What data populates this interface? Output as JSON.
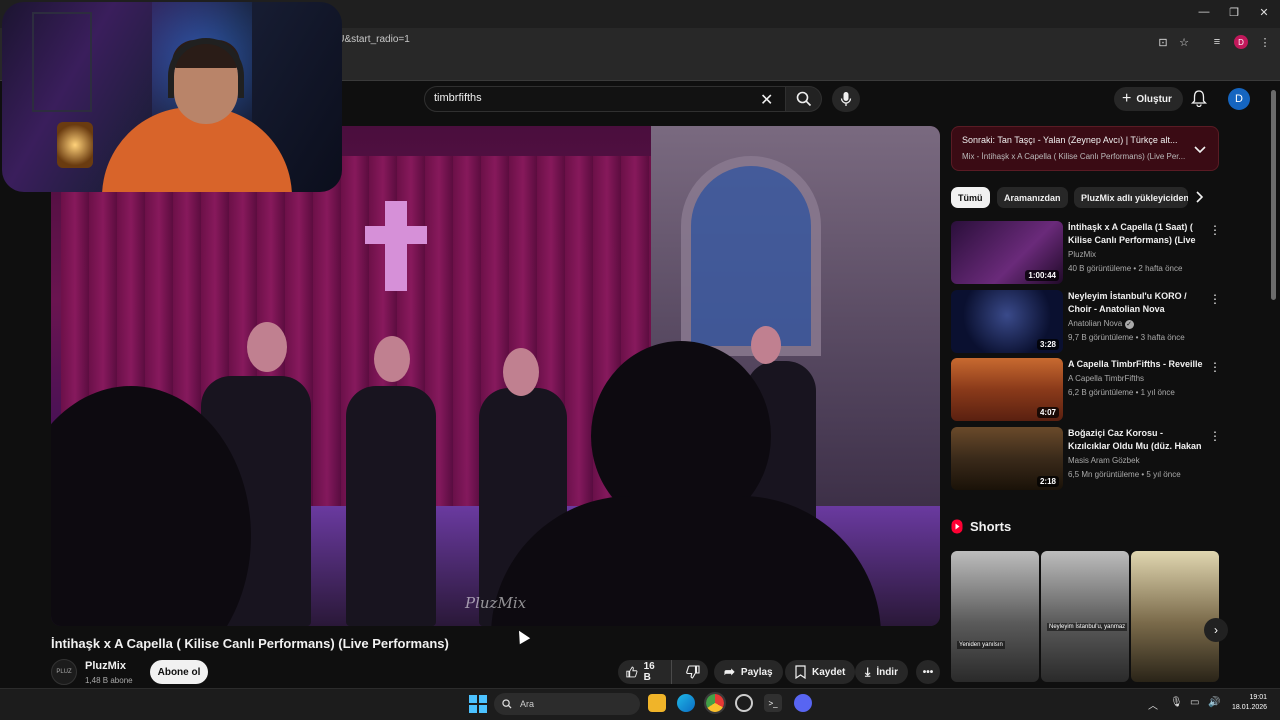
{
  "browser": {
    "url_fragment": "0uvJvbuU&start_radio=1",
    "profile_initial": "D",
    "window_controls": [
      "minimize",
      "maximize",
      "close"
    ]
  },
  "header": {
    "search_value": "timbrfifths",
    "create_label": "Oluştur",
    "avatar_initial": "D"
  },
  "video": {
    "title": "İntihaşk x A Capella ( Kilise Canlı Performans) (Live Performans)",
    "watermark": "PluzMix",
    "channel_name": "PluzMix",
    "channel_avatar_text": "PLUZ",
    "subscribers": "1,48 B abone",
    "subscribe_label": "Abone ol",
    "likes": "16 B",
    "share_label": "Paylaş",
    "save_label": "Kaydet",
    "download_label": "İndir"
  },
  "up_next": {
    "title": "Sonraki: Tan Taşçı - Yalan (Zeynep Avcı) | Türkçe alt...",
    "subtitle": "Mix - İntihaşk x A Capella ( Kilise Canlı Performans) (Live Per..."
  },
  "chips": [
    "Tümü",
    "Aramanızdan",
    "PluzMix adlı yükleyiciden"
  ],
  "recommendations": [
    {
      "title": "İntihaşk x A Capella (1 Saat) ( Kilise Canlı Performans) (Live ...",
      "channel": "PluzMix",
      "meta": "40 B görüntüleme • 2 hafta önce",
      "duration": "1:00:44",
      "thumb_color": "#4a1a5c"
    },
    {
      "title": "Neyleyim İstanbul'u KORO / Choir - Anatolian Nova",
      "channel": "Anatolian Nova",
      "meta": "9,7 B görüntüleme • 3 hafta önce",
      "duration": "3:28",
      "thumb_color": "#0a1030",
      "verified": true
    },
    {
      "title": "A Capella TimbrFifths - Reveille",
      "channel": "A Capella TimbrFifths",
      "meta": "6,2 B görüntüleme • 1 yıl önce",
      "duration": "4:07",
      "thumb_color": "#8a3a1a"
    },
    {
      "title": "Boğaziçi Caz Korosu - Kızılcıklar Oldu Mu (düz. Hakan Önsöz)",
      "channel": "Masis Aram Gözbek",
      "meta": "6,5 Mn görüntüleme • 5 yıl önce",
      "duration": "2:18",
      "thumb_color": "#3a2a1a"
    }
  ],
  "shorts": {
    "label": "Shorts",
    "captions": [
      "Yeniden yanılsın",
      "Neyleyim İstanbul'u, yanmaz",
      ""
    ]
  },
  "taskbar": {
    "search_placeholder": "Ara",
    "time": "19:01",
    "date": "18.01.2026"
  },
  "colors": {
    "accent_red": "#ff0033",
    "next_box": "#3a0b14",
    "windows_blue": "#4cc2ff"
  }
}
